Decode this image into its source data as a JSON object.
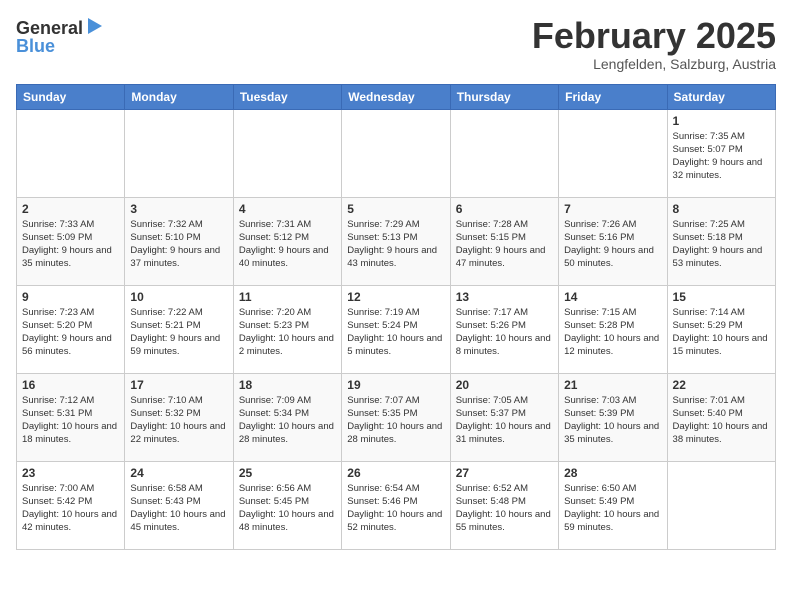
{
  "header": {
    "logo_general": "General",
    "logo_blue": "Blue",
    "month_title": "February 2025",
    "location": "Lengfelden, Salzburg, Austria"
  },
  "days_of_week": [
    "Sunday",
    "Monday",
    "Tuesday",
    "Wednesday",
    "Thursday",
    "Friday",
    "Saturday"
  ],
  "weeks": [
    [
      {
        "day": "",
        "info": ""
      },
      {
        "day": "",
        "info": ""
      },
      {
        "day": "",
        "info": ""
      },
      {
        "day": "",
        "info": ""
      },
      {
        "day": "",
        "info": ""
      },
      {
        "day": "",
        "info": ""
      },
      {
        "day": "1",
        "info": "Sunrise: 7:35 AM\nSunset: 5:07 PM\nDaylight: 9 hours and 32 minutes."
      }
    ],
    [
      {
        "day": "2",
        "info": "Sunrise: 7:33 AM\nSunset: 5:09 PM\nDaylight: 9 hours and 35 minutes."
      },
      {
        "day": "3",
        "info": "Sunrise: 7:32 AM\nSunset: 5:10 PM\nDaylight: 9 hours and 37 minutes."
      },
      {
        "day": "4",
        "info": "Sunrise: 7:31 AM\nSunset: 5:12 PM\nDaylight: 9 hours and 40 minutes."
      },
      {
        "day": "5",
        "info": "Sunrise: 7:29 AM\nSunset: 5:13 PM\nDaylight: 9 hours and 43 minutes."
      },
      {
        "day": "6",
        "info": "Sunrise: 7:28 AM\nSunset: 5:15 PM\nDaylight: 9 hours and 47 minutes."
      },
      {
        "day": "7",
        "info": "Sunrise: 7:26 AM\nSunset: 5:16 PM\nDaylight: 9 hours and 50 minutes."
      },
      {
        "day": "8",
        "info": "Sunrise: 7:25 AM\nSunset: 5:18 PM\nDaylight: 9 hours and 53 minutes."
      }
    ],
    [
      {
        "day": "9",
        "info": "Sunrise: 7:23 AM\nSunset: 5:20 PM\nDaylight: 9 hours and 56 minutes."
      },
      {
        "day": "10",
        "info": "Sunrise: 7:22 AM\nSunset: 5:21 PM\nDaylight: 9 hours and 59 minutes."
      },
      {
        "day": "11",
        "info": "Sunrise: 7:20 AM\nSunset: 5:23 PM\nDaylight: 10 hours and 2 minutes."
      },
      {
        "day": "12",
        "info": "Sunrise: 7:19 AM\nSunset: 5:24 PM\nDaylight: 10 hours and 5 minutes."
      },
      {
        "day": "13",
        "info": "Sunrise: 7:17 AM\nSunset: 5:26 PM\nDaylight: 10 hours and 8 minutes."
      },
      {
        "day": "14",
        "info": "Sunrise: 7:15 AM\nSunset: 5:28 PM\nDaylight: 10 hours and 12 minutes."
      },
      {
        "day": "15",
        "info": "Sunrise: 7:14 AM\nSunset: 5:29 PM\nDaylight: 10 hours and 15 minutes."
      }
    ],
    [
      {
        "day": "16",
        "info": "Sunrise: 7:12 AM\nSunset: 5:31 PM\nDaylight: 10 hours and 18 minutes."
      },
      {
        "day": "17",
        "info": "Sunrise: 7:10 AM\nSunset: 5:32 PM\nDaylight: 10 hours and 22 minutes."
      },
      {
        "day": "18",
        "info": "Sunrise: 7:09 AM\nSunset: 5:34 PM\nDaylight: 10 hours and 28 minutes."
      },
      {
        "day": "19",
        "info": "Sunrise: 7:07 AM\nSunset: 5:35 PM\nDaylight: 10 hours and 28 minutes."
      },
      {
        "day": "20",
        "info": "Sunrise: 7:05 AM\nSunset: 5:37 PM\nDaylight: 10 hours and 31 minutes."
      },
      {
        "day": "21",
        "info": "Sunrise: 7:03 AM\nSunset: 5:39 PM\nDaylight: 10 hours and 35 minutes."
      },
      {
        "day": "22",
        "info": "Sunrise: 7:01 AM\nSunset: 5:40 PM\nDaylight: 10 hours and 38 minutes."
      }
    ],
    [
      {
        "day": "23",
        "info": "Sunrise: 7:00 AM\nSunset: 5:42 PM\nDaylight: 10 hours and 42 minutes."
      },
      {
        "day": "24",
        "info": "Sunrise: 6:58 AM\nSunset: 5:43 PM\nDaylight: 10 hours and 45 minutes."
      },
      {
        "day": "25",
        "info": "Sunrise: 6:56 AM\nSunset: 5:45 PM\nDaylight: 10 hours and 48 minutes."
      },
      {
        "day": "26",
        "info": "Sunrise: 6:54 AM\nSunset: 5:46 PM\nDaylight: 10 hours and 52 minutes."
      },
      {
        "day": "27",
        "info": "Sunrise: 6:52 AM\nSunset: 5:48 PM\nDaylight: 10 hours and 55 minutes."
      },
      {
        "day": "28",
        "info": "Sunrise: 6:50 AM\nSunset: 5:49 PM\nDaylight: 10 hours and 59 minutes."
      },
      {
        "day": "",
        "info": ""
      }
    ]
  ]
}
